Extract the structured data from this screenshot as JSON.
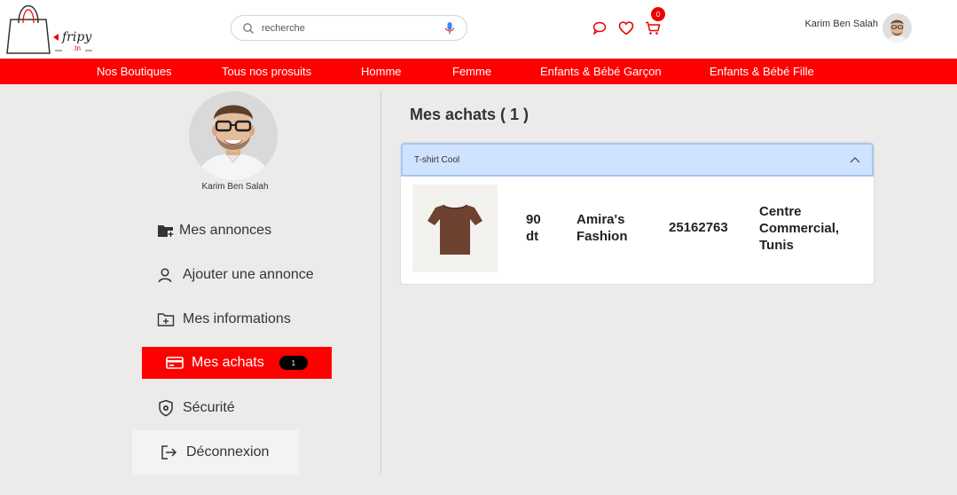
{
  "header": {
    "logo_text": "fripy",
    "logo_domain": ".tn",
    "search_placeholder": "recherche",
    "cart_count": "0",
    "user_name": "Karim Ben Salah"
  },
  "nav": {
    "items": [
      {
        "label": "Nos Boutiques"
      },
      {
        "label": "Tous nos prosuits"
      },
      {
        "label": "Homme"
      },
      {
        "label": "Femme"
      },
      {
        "label": "Enfants & Bébé Garçon"
      },
      {
        "label": "Enfants & Bébé Fille"
      }
    ]
  },
  "sidebar": {
    "profile_name": "Karim Ben Salah",
    "items": [
      {
        "label": "Mes annonces",
        "icon": "folder-plus-icon"
      },
      {
        "label": "Ajouter une annonce",
        "icon": "user-icon"
      },
      {
        "label": "Mes informations",
        "icon": "folder-add-icon"
      },
      {
        "label": "Mes achats",
        "icon": "credit-card-icon",
        "badge": "1",
        "active": true
      },
      {
        "label": "Sécurité",
        "icon": "shield-gear-icon"
      },
      {
        "label": "Déconnexion",
        "icon": "logout-icon"
      }
    ]
  },
  "main": {
    "title": "Mes achats ( 1 )",
    "purchase": {
      "item_name": "T-shirt Cool",
      "price": "90 dt",
      "price_line1": "90",
      "price_line2": "dt",
      "shop_line1": "Amira's",
      "shop_line2": "Fashion",
      "phone": "25162763",
      "address_line1": "Centre",
      "address_line2": "Commercial,",
      "address_line3": "Tunis"
    }
  },
  "colors": {
    "brand_red": "#ff0000",
    "accordion_header": "#cfe2ff",
    "background": "#ecebe9"
  }
}
